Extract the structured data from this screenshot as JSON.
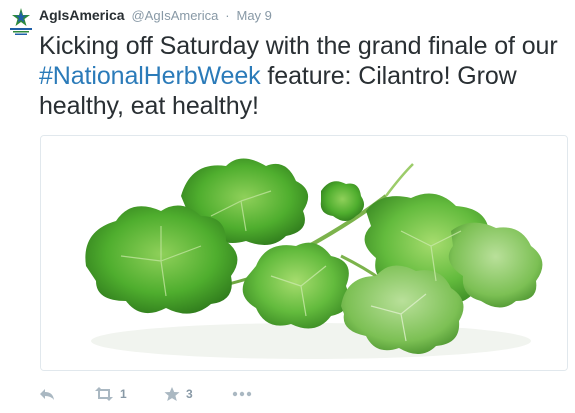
{
  "tweet": {
    "display_name": "AgIsAmerica",
    "handle": "@AgIsAmerica",
    "separator": "·",
    "time": "May 9",
    "text_before": "Kicking off Saturday with the grand finale of our ",
    "hashtag": "#NationalHerbWeek",
    "text_after": " feature: Cilantro! Grow healthy, eat healthy!",
    "avatar_logo_text": "AGRICULTURE IS AMERICA"
  },
  "actions": {
    "reply_icon": "reply-arrow-icon",
    "retweet_icon": "retweet-icon",
    "retweet_count": "1",
    "favorite_icon": "star-icon",
    "favorite_count": "3",
    "more_icon": "ellipsis-icon"
  },
  "colors": {
    "link": "#2b7bb9",
    "text": "#292f33",
    "muted": "#8899a6",
    "icon": "#aab8c2",
    "leaf": "#3f9a2c"
  }
}
